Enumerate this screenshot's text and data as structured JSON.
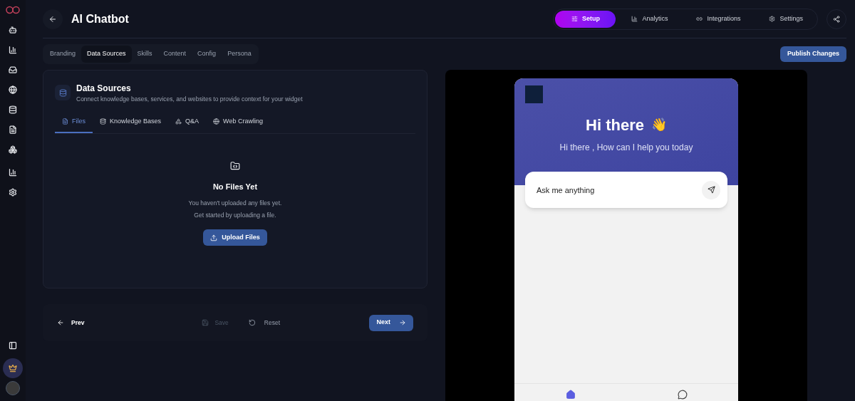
{
  "sidebar": {
    "items": [
      {
        "kind": "bot",
        "selected": false
      },
      {
        "kind": "chart",
        "selected": false
      },
      {
        "kind": "inbox",
        "selected": false
      },
      {
        "kind": "globe",
        "selected": false
      },
      {
        "kind": "database",
        "selected": false
      },
      {
        "kind": "file",
        "selected": false
      },
      {
        "kind": "boxes",
        "selected": false
      },
      {
        "kind": "chart",
        "selected": false
      },
      {
        "kind": "settings",
        "selected": false
      }
    ],
    "bottom_items": [
      {
        "kind": "panel",
        "selected": false
      },
      {
        "kind": "crown",
        "selected": true
      }
    ]
  },
  "header": {
    "title": "AI Chatbot"
  },
  "nav_tabs": [
    {
      "label": "Setup",
      "kind": "setup",
      "selected": true
    },
    {
      "label": "Analytics",
      "kind": "chart",
      "selected": false
    },
    {
      "label": "Integrations",
      "kind": "link",
      "selected": false
    },
    {
      "label": "Settings",
      "kind": "settings",
      "selected": false
    }
  ],
  "section_tabs": [
    {
      "label": "Branding",
      "selected": false
    },
    {
      "label": "Data Sources",
      "selected": true
    },
    {
      "label": "Skills",
      "selected": false
    },
    {
      "label": "Content",
      "selected": false
    },
    {
      "label": "Config",
      "selected": false
    },
    {
      "label": "Persona",
      "selected": false
    }
  ],
  "publish_button": "Publish Changes",
  "card": {
    "title": "Data Sources",
    "subtitle": "Connect knowledge bases, services, and websites to provide context for your widget",
    "tabs": [
      {
        "label": "Files",
        "kind": "file",
        "selected": true
      },
      {
        "label": "Knowledge Bases",
        "kind": "database",
        "selected": false
      },
      {
        "label": "Q&A",
        "kind": "qa",
        "selected": false
      },
      {
        "label": "Web Crawling",
        "kind": "globe",
        "selected": false
      }
    ],
    "empty_title": "No Files Yet",
    "empty_lines": [
      "You haven't uploaded any files yet.",
      "Get started by uploading a file."
    ],
    "upload_button": "Upload Files"
  },
  "footer": {
    "prev": "Prev",
    "save": {
      "label": "Save",
      "disabled": true
    },
    "reset": "Reset",
    "next": "Next"
  },
  "preview": {
    "greeting": "Hi there",
    "emoji": "👋",
    "subtitle": "Hi there , How can I help you today",
    "input_placeholder": "Ask me anything",
    "bottom_tabs": [
      {
        "kind": "home",
        "selected": true
      },
      {
        "kind": "messages",
        "selected": false
      }
    ]
  }
}
